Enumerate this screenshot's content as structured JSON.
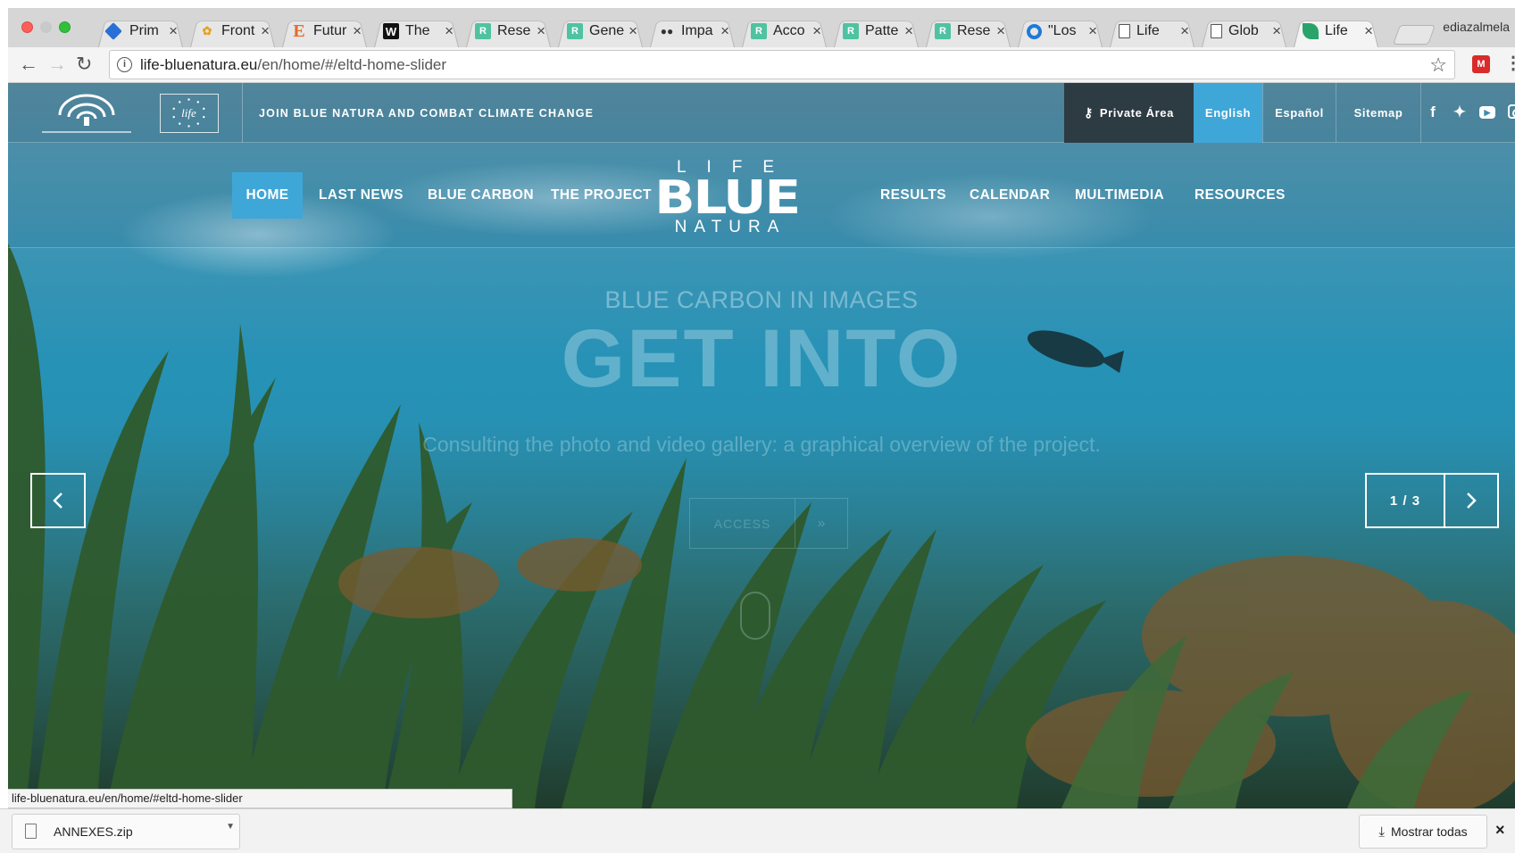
{
  "browser": {
    "user_name": "ediazalmela",
    "tabs": [
      {
        "title": "Prim",
        "icon": "diamond-favicon"
      },
      {
        "title": "Front",
        "icon": "colorful-favicon"
      },
      {
        "title": "Futur",
        "icon": "letter-e-favicon"
      },
      {
        "title": "The",
        "icon": "letter-w-favicon"
      },
      {
        "title": "Rese",
        "icon": "researchgate-favicon"
      },
      {
        "title": "Gene",
        "icon": "researchgate-favicon"
      },
      {
        "title": "Impa",
        "icon": "people-favicon"
      },
      {
        "title": "Acco",
        "icon": "researchgate-favicon"
      },
      {
        "title": "Patte",
        "icon": "researchgate-favicon"
      },
      {
        "title": "Rese",
        "icon": "researchgate-favicon"
      },
      {
        "title": "\"Los",
        "icon": "ring-favicon"
      },
      {
        "title": "Life",
        "icon": "document-favicon"
      },
      {
        "title": "Glob",
        "icon": "document-favicon"
      },
      {
        "title": "Life",
        "icon": "leaf-favicon",
        "active": true
      }
    ],
    "url_host": "life-bluenatura.eu",
    "url_path": "/en/home/#/eltd-home-slider",
    "status_url": "life-bluenatura.eu/en/home/#eltd-home-slider"
  },
  "site": {
    "slogan": "JOIN BLUE NATURA AND COMBAT CLIMATE CHANGE",
    "top_links": {
      "private": "Private Área",
      "english": "English",
      "espanol": "Español",
      "sitemap": "Sitemap"
    },
    "logo_life_text": "life",
    "nav": {
      "home": "HOME",
      "last_news": "LAST NEWS",
      "blue_carbon": "BLUE CARBON",
      "the_project": "THE PROJECT",
      "results": "RESULTS",
      "calendar": "CALENDAR",
      "multimedia": "MULTIMEDIA",
      "resources": "RESOURCES"
    },
    "brand": {
      "life": "LIFE",
      "blue": "BLUE",
      "natura": "NATURA"
    },
    "hero": {
      "kicker": "BLUE CARBON IN IMAGES",
      "title": "GET INTO",
      "description": "Consulting the photo and video gallery: a graphical overview of the project.",
      "cta_label": "ACCESS",
      "counter": "1 / 3"
    }
  },
  "downloads": {
    "file_name": "ANNEXES.zip",
    "show_all": "Mostrar todas"
  },
  "colors": {
    "accent_blue": "#3fa6d8",
    "private_bg": "#2d3b42"
  }
}
